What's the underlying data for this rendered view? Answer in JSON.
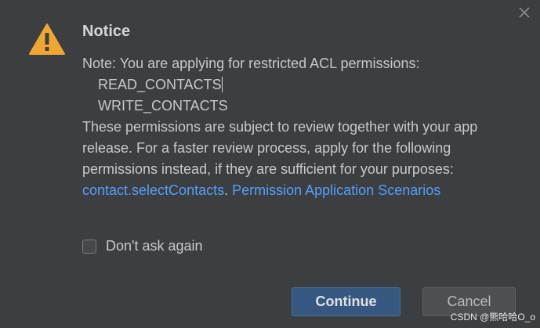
{
  "dialog": {
    "title": "Notice",
    "note_line": "Note: You are applying for restricted ACL permissions:",
    "permissions": [
      "READ_CONTACTS",
      "WRITE_CONTACTS"
    ],
    "body_text": "These permissions are subject to review together with your app release. For a faster review process, apply for the following permissions instead, if they are sufficient for your purposes: ",
    "link_select_contacts": "contact.selectContacts",
    "separator": ". ",
    "link_permission_scenarios": "Permission Application Scenarios",
    "checkbox_label": "Don't ask again",
    "continue_label": "Continue",
    "cancel_label": "Cancel"
  },
  "icons": {
    "warning": "warning-icon",
    "close": "close-icon"
  },
  "colors": {
    "background": "#3c3f41",
    "link": "#589df6",
    "primary_button": "#365880",
    "warning": "#f0a732"
  },
  "watermark": "CSDN @熊哈哈O_o"
}
